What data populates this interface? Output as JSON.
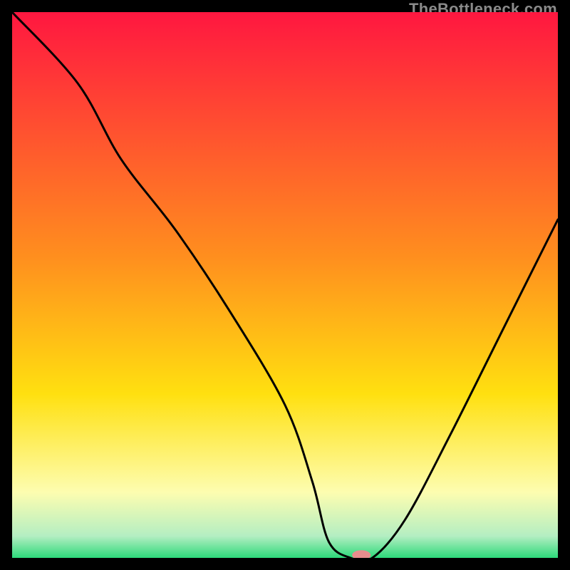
{
  "watermark": "TheBottleneck.com",
  "chart_data": {
    "type": "line",
    "title": "",
    "xlabel": "",
    "ylabel": "",
    "xlim": [
      0,
      100
    ],
    "ylim": [
      0,
      100
    ],
    "x": [
      0,
      12,
      20,
      30,
      40,
      50,
      55,
      58,
      62,
      66,
      72,
      80,
      90,
      100
    ],
    "y": [
      100,
      87,
      73,
      60,
      45,
      28,
      14,
      3,
      0,
      0,
      7,
      22,
      42,
      62
    ],
    "marker": {
      "x": 64,
      "y": 0.5
    },
    "gradient_top_color": "#ff1740",
    "gradient_mid1_color": "#ff8f1e",
    "gradient_mid2_color": "#ffe010",
    "gradient_band_color": "#fdfdb0",
    "gradient_bottom_color": "#2dd97a",
    "frame_color": "#000000"
  }
}
